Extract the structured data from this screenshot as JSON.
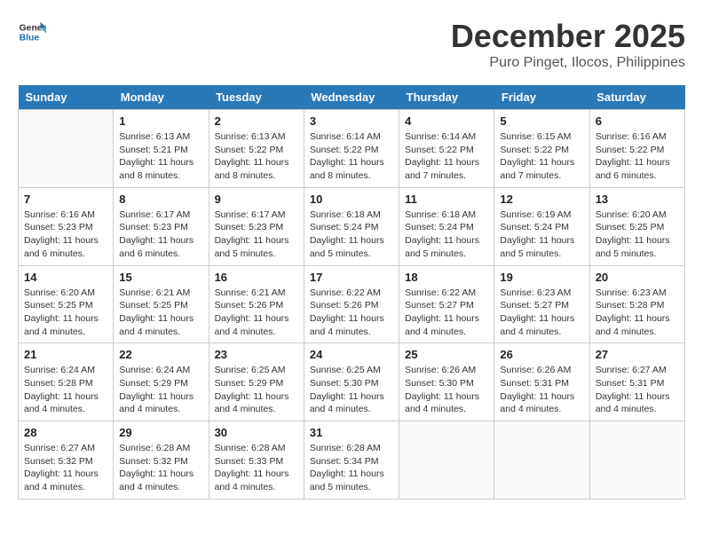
{
  "logo": {
    "line1": "General",
    "line2": "Blue"
  },
  "title": "December 2025",
  "subtitle": "Puro Pinget, Ilocos, Philippines",
  "days_of_week": [
    "Sunday",
    "Monday",
    "Tuesday",
    "Wednesday",
    "Thursday",
    "Friday",
    "Saturday"
  ],
  "weeks": [
    [
      {
        "day": "",
        "info": ""
      },
      {
        "day": "1",
        "info": "Sunrise: 6:13 AM\nSunset: 5:21 PM\nDaylight: 11 hours\nand 8 minutes."
      },
      {
        "day": "2",
        "info": "Sunrise: 6:13 AM\nSunset: 5:22 PM\nDaylight: 11 hours\nand 8 minutes."
      },
      {
        "day": "3",
        "info": "Sunrise: 6:14 AM\nSunset: 5:22 PM\nDaylight: 11 hours\nand 8 minutes."
      },
      {
        "day": "4",
        "info": "Sunrise: 6:14 AM\nSunset: 5:22 PM\nDaylight: 11 hours\nand 7 minutes."
      },
      {
        "day": "5",
        "info": "Sunrise: 6:15 AM\nSunset: 5:22 PM\nDaylight: 11 hours\nand 7 minutes."
      },
      {
        "day": "6",
        "info": "Sunrise: 6:16 AM\nSunset: 5:22 PM\nDaylight: 11 hours\nand 6 minutes."
      }
    ],
    [
      {
        "day": "7",
        "info": "Sunrise: 6:16 AM\nSunset: 5:23 PM\nDaylight: 11 hours\nand 6 minutes."
      },
      {
        "day": "8",
        "info": "Sunrise: 6:17 AM\nSunset: 5:23 PM\nDaylight: 11 hours\nand 6 minutes."
      },
      {
        "day": "9",
        "info": "Sunrise: 6:17 AM\nSunset: 5:23 PM\nDaylight: 11 hours\nand 5 minutes."
      },
      {
        "day": "10",
        "info": "Sunrise: 6:18 AM\nSunset: 5:24 PM\nDaylight: 11 hours\nand 5 minutes."
      },
      {
        "day": "11",
        "info": "Sunrise: 6:18 AM\nSunset: 5:24 PM\nDaylight: 11 hours\nand 5 minutes."
      },
      {
        "day": "12",
        "info": "Sunrise: 6:19 AM\nSunset: 5:24 PM\nDaylight: 11 hours\nand 5 minutes."
      },
      {
        "day": "13",
        "info": "Sunrise: 6:20 AM\nSunset: 5:25 PM\nDaylight: 11 hours\nand 5 minutes."
      }
    ],
    [
      {
        "day": "14",
        "info": "Sunrise: 6:20 AM\nSunset: 5:25 PM\nDaylight: 11 hours\nand 4 minutes."
      },
      {
        "day": "15",
        "info": "Sunrise: 6:21 AM\nSunset: 5:25 PM\nDaylight: 11 hours\nand 4 minutes."
      },
      {
        "day": "16",
        "info": "Sunrise: 6:21 AM\nSunset: 5:26 PM\nDaylight: 11 hours\nand 4 minutes."
      },
      {
        "day": "17",
        "info": "Sunrise: 6:22 AM\nSunset: 5:26 PM\nDaylight: 11 hours\nand 4 minutes."
      },
      {
        "day": "18",
        "info": "Sunrise: 6:22 AM\nSunset: 5:27 PM\nDaylight: 11 hours\nand 4 minutes."
      },
      {
        "day": "19",
        "info": "Sunrise: 6:23 AM\nSunset: 5:27 PM\nDaylight: 11 hours\nand 4 minutes."
      },
      {
        "day": "20",
        "info": "Sunrise: 6:23 AM\nSunset: 5:28 PM\nDaylight: 11 hours\nand 4 minutes."
      }
    ],
    [
      {
        "day": "21",
        "info": "Sunrise: 6:24 AM\nSunset: 5:28 PM\nDaylight: 11 hours\nand 4 minutes."
      },
      {
        "day": "22",
        "info": "Sunrise: 6:24 AM\nSunset: 5:29 PM\nDaylight: 11 hours\nand 4 minutes."
      },
      {
        "day": "23",
        "info": "Sunrise: 6:25 AM\nSunset: 5:29 PM\nDaylight: 11 hours\nand 4 minutes."
      },
      {
        "day": "24",
        "info": "Sunrise: 6:25 AM\nSunset: 5:30 PM\nDaylight: 11 hours\nand 4 minutes."
      },
      {
        "day": "25",
        "info": "Sunrise: 6:26 AM\nSunset: 5:30 PM\nDaylight: 11 hours\nand 4 minutes."
      },
      {
        "day": "26",
        "info": "Sunrise: 6:26 AM\nSunset: 5:31 PM\nDaylight: 11 hours\nand 4 minutes."
      },
      {
        "day": "27",
        "info": "Sunrise: 6:27 AM\nSunset: 5:31 PM\nDaylight: 11 hours\nand 4 minutes."
      }
    ],
    [
      {
        "day": "28",
        "info": "Sunrise: 6:27 AM\nSunset: 5:32 PM\nDaylight: 11 hours\nand 4 minutes."
      },
      {
        "day": "29",
        "info": "Sunrise: 6:28 AM\nSunset: 5:32 PM\nDaylight: 11 hours\nand 4 minutes."
      },
      {
        "day": "30",
        "info": "Sunrise: 6:28 AM\nSunset: 5:33 PM\nDaylight: 11 hours\nand 4 minutes."
      },
      {
        "day": "31",
        "info": "Sunrise: 6:28 AM\nSunset: 5:34 PM\nDaylight: 11 hours\nand 5 minutes."
      },
      {
        "day": "",
        "info": ""
      },
      {
        "day": "",
        "info": ""
      },
      {
        "day": "",
        "info": ""
      }
    ]
  ]
}
